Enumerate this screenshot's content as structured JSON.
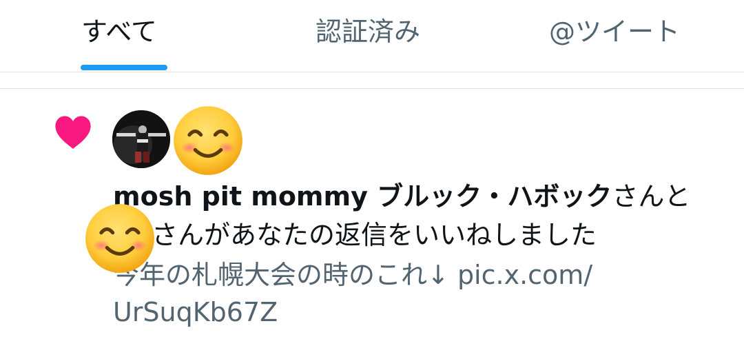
{
  "tabs": [
    {
      "label": "すべて",
      "active": true
    },
    {
      "label": "認証済み",
      "active": false
    },
    {
      "label": "@ツイート",
      "active": false
    }
  ],
  "colors": {
    "accent": "#1d9bf0",
    "like_heart": "#f91880",
    "text_primary": "#0f1419",
    "text_secondary": "#536471"
  },
  "notification": {
    "type_icon": "heart-icon",
    "avatars": [
      {
        "kind": "photo",
        "icon": "user-avatar-photo"
      },
      {
        "kind": "emoji",
        "icon": "smiling-face-emoji"
      }
    ],
    "overlay_icon": "smiling-face-emoji",
    "user_name": "mosh pit mommy ブルック・ハボック",
    "suffix_1": "さんと",
    "line_2": "さんがあなたの返信をいいねしました",
    "tweet_text": "今年の札幌大会の時のこれ↓",
    "link_part_1": "pic.x.com/",
    "link_part_2": "UrSuqKb67Z"
  }
}
